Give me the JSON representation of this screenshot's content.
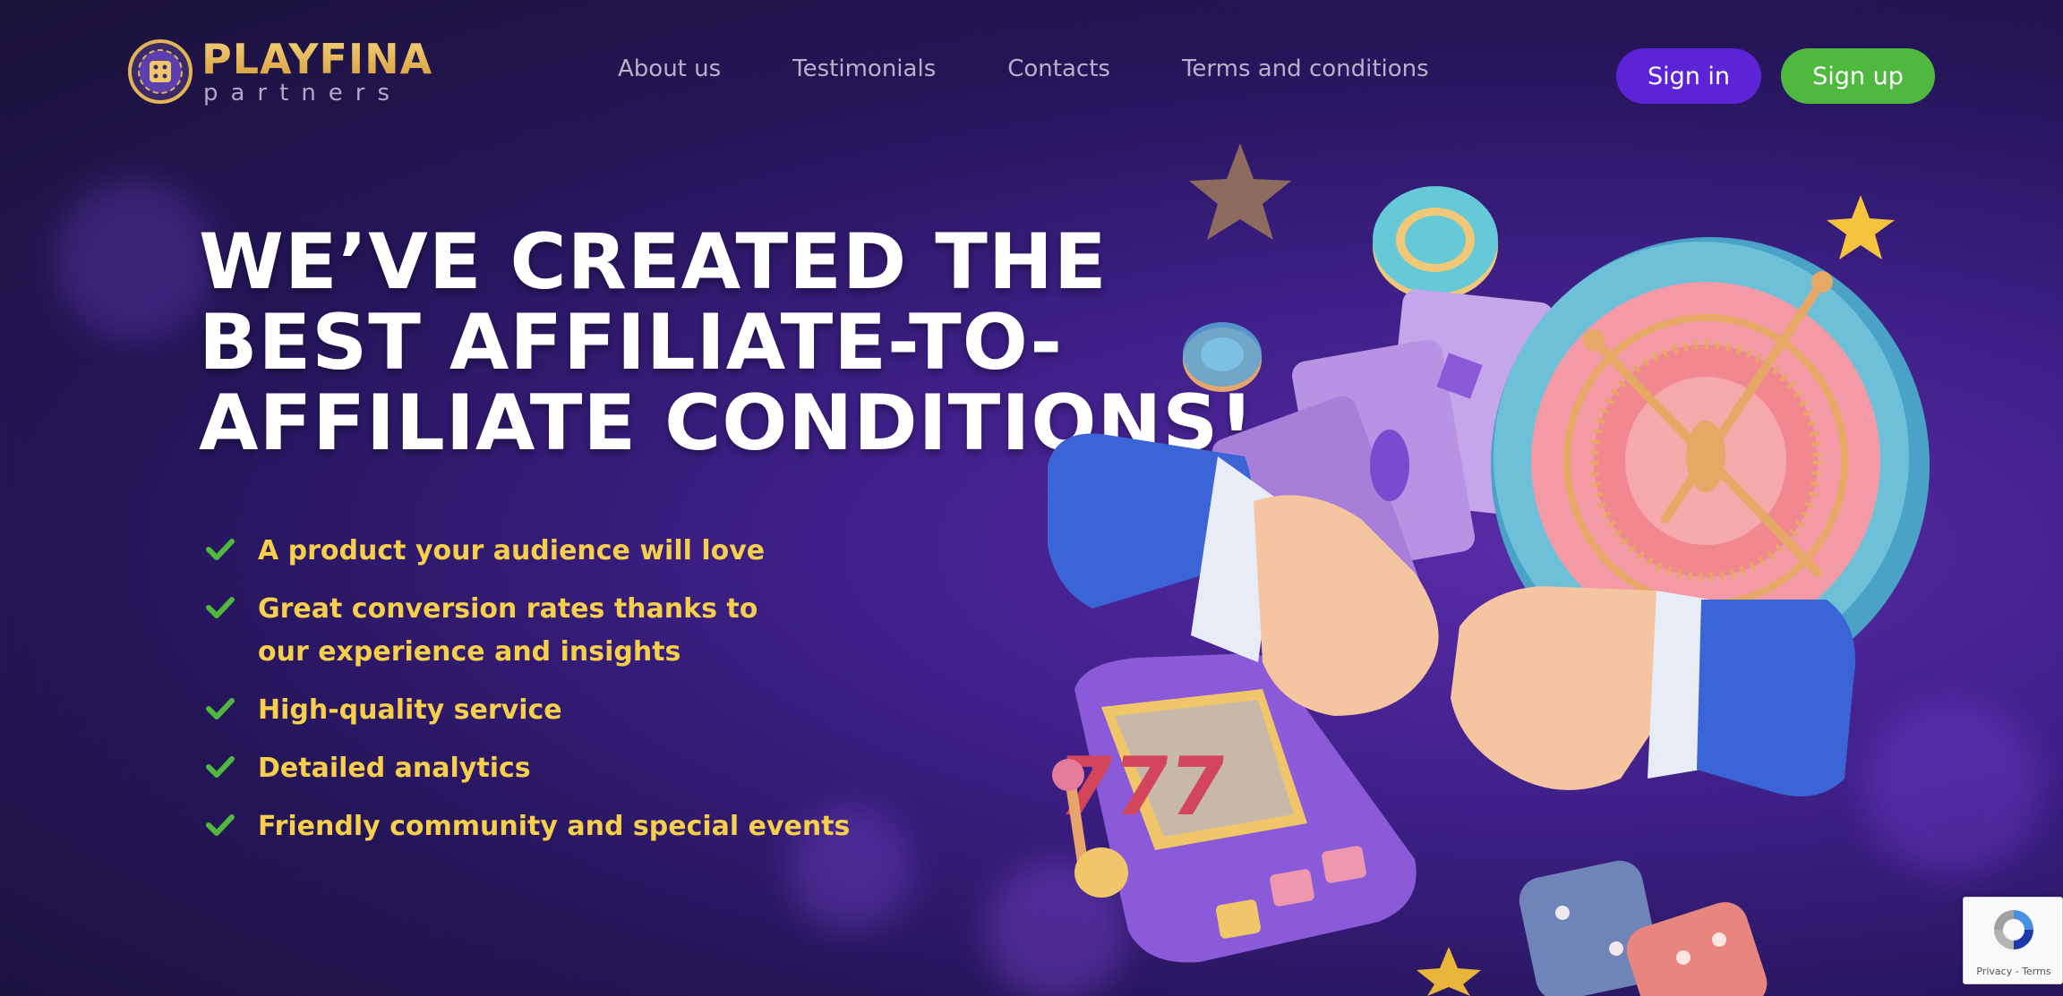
{
  "brand": {
    "name": "PLAYFINA",
    "tagline": "partners"
  },
  "nav": {
    "items": [
      {
        "label": "About us"
      },
      {
        "label": "Testimonials"
      },
      {
        "label": "Contacts"
      },
      {
        "label": "Terms and conditions"
      }
    ]
  },
  "auth": {
    "signin_label": "Sign in",
    "signup_label": "Sign up"
  },
  "hero": {
    "headline_line1": "WE’VE CREATED THE",
    "headline_line2": "BEST AFFILIATE-TO-",
    "headline_line3": "AFFILIATE CONDITIONS!",
    "features": [
      {
        "text": "A product your audience will love"
      },
      {
        "text": "Great conversion rates thanks to our experience and insights"
      },
      {
        "text": "High-quality service"
      },
      {
        "text": "Detailed analytics"
      },
      {
        "text": "Friendly community and special events"
      }
    ]
  },
  "recaptcha": {
    "privacy_label": "Privacy",
    "separator": " - ",
    "terms_label": "Terms"
  },
  "colors": {
    "signin": "#5c24d6",
    "signup": "#4fb83e",
    "feature_text": "#f7cf4a",
    "check": "#4fb83e"
  },
  "icons": {
    "logo": "dice-chip-icon",
    "check": "check-icon",
    "recaptcha": "recaptcha-icon"
  }
}
